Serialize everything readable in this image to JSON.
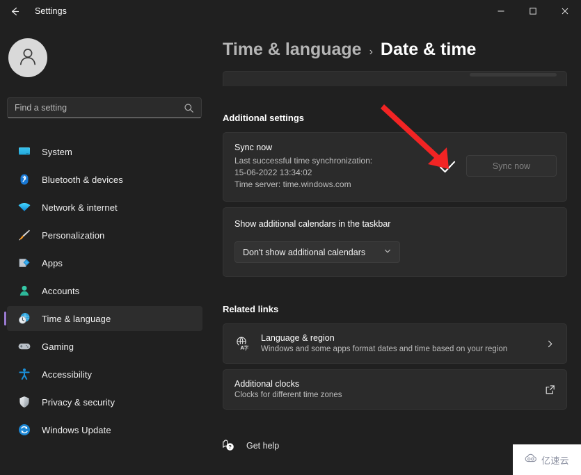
{
  "window": {
    "app_title": "Settings",
    "back_icon": "back-arrow-icon",
    "minimize_label": "—",
    "maximize_label": "□",
    "close_label": "✕"
  },
  "sidebar": {
    "avatar_icon": "user-avatar-icon",
    "search": {
      "placeholder": "Find a setting",
      "value": "",
      "icon": "search-icon"
    },
    "items": [
      {
        "label": "System",
        "icon": "system-monitor-icon",
        "selected": false
      },
      {
        "label": "Bluetooth & devices",
        "icon": "bluetooth-icon",
        "selected": false
      },
      {
        "label": "Network & internet",
        "icon": "wifi-icon",
        "selected": false
      },
      {
        "label": "Personalization",
        "icon": "paintbrush-icon",
        "selected": false
      },
      {
        "label": "Apps",
        "icon": "apps-icon",
        "selected": false
      },
      {
        "label": "Accounts",
        "icon": "accounts-person-icon",
        "selected": false
      },
      {
        "label": "Time & language",
        "icon": "clock-globe-icon",
        "selected": true
      },
      {
        "label": "Gaming",
        "icon": "gamepad-icon",
        "selected": false
      },
      {
        "label": "Accessibility",
        "icon": "accessibility-person-icon",
        "selected": false
      },
      {
        "label": "Privacy & security",
        "icon": "shield-icon",
        "selected": false
      },
      {
        "label": "Windows Update",
        "icon": "update-refresh-icon",
        "selected": false
      }
    ]
  },
  "main": {
    "breadcrumb": {
      "parent": "Time & language",
      "separator": "›",
      "current": "Date & time"
    },
    "additional_settings_heading": "Additional settings",
    "sync_card": {
      "title": "Sync now",
      "status_line": "Last successful time synchronization:",
      "timestamp": "15-06-2022 13:34:02",
      "time_server": "Time server: time.windows.com",
      "button_label": "Sync now",
      "button_disabled": true,
      "check_icon": "checkmark-icon"
    },
    "calendar_card": {
      "label": "Show additional calendars in the taskbar",
      "dropdown_value": "Don't show additional calendars",
      "dropdown_icon": "chevron-down-icon"
    },
    "related_links_heading": "Related links",
    "links": [
      {
        "title": "Language & region",
        "subtitle": "Windows and some apps format dates and time based on your region",
        "icon": "translate-globe-icon",
        "end_icon": "chevron-right-icon"
      },
      {
        "title": "Additional clocks",
        "subtitle": "Clocks for different time zones",
        "icon": "",
        "end_icon": "external-link-icon"
      }
    ],
    "get_help": {
      "label": "Get help",
      "icon": "help-question-icon"
    }
  },
  "annotation": {
    "arrow_color": "#f22424",
    "arrow_name": "red-pointer-arrow"
  },
  "watermark": {
    "text": "亿速云",
    "icon": "cloud-logo-icon"
  },
  "colors": {
    "window_bg": "#202020",
    "card_bg": "#2b2b2b",
    "accent": "#9a7ad1",
    "text_primary": "#ffffff",
    "text_secondary": "#bdbdbd"
  }
}
